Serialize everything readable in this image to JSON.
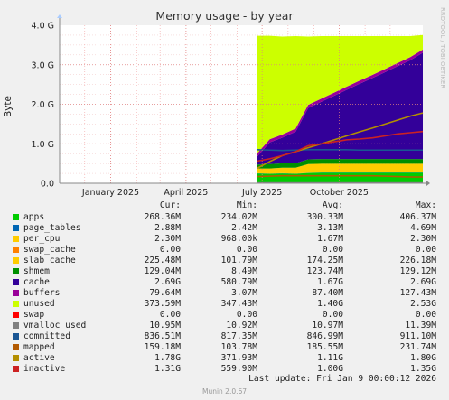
{
  "chart_data": {
    "type": "area",
    "title": "Memory usage - by year",
    "ylabel": "Bytes",
    "side_label": "RRDTOOL / TOBI OETIKER",
    "y_ticks": [
      "0.0",
      "1.0 G",
      "2.0 G",
      "3.0 G",
      "4.0 G"
    ],
    "y_tick_values": [
      0,
      1,
      2,
      3,
      4
    ],
    "ylim": [
      0,
      4
    ],
    "x_ticks": [
      "January 2025",
      "April 2025",
      "July 2025",
      "October 2025"
    ],
    "x_tick_values": [
      "2025-01-01",
      "2025-04-01",
      "2025-07-01",
      "2025-10-01"
    ],
    "xlim": [
      "2024-11-01",
      "2026-01-09"
    ],
    "data_start": "2025-06-25",
    "unit": "GB",
    "x": [
      "2025-06-25",
      "2025-07-10",
      "2025-07-25",
      "2025-08-10",
      "2025-08-25",
      "2025-09-10",
      "2025-09-25",
      "2025-10-10",
      "2025-10-25",
      "2025-11-10",
      "2025-11-25",
      "2025-12-10",
      "2025-12-25",
      "2026-01-09"
    ],
    "stack": [
      {
        "name": "apps",
        "color": "#00cc00",
        "values": [
          0.25,
          0.24,
          0.25,
          0.24,
          0.26,
          0.27,
          0.27,
          0.27,
          0.27,
          0.27,
          0.27,
          0.27,
          0.27,
          0.27
        ]
      },
      {
        "name": "page_tables",
        "color": "#0066b3",
        "values": [
          0.003,
          0.003,
          0.003,
          0.003,
          0.003,
          0.003,
          0.003,
          0.003,
          0.003,
          0.003,
          0.003,
          0.003,
          0.003,
          0.003
        ]
      },
      {
        "name": "per_cpu",
        "color": "#ff8000",
        "values": [
          0.002,
          0.002,
          0.002,
          0.002,
          0.002,
          0.002,
          0.002,
          0.002,
          0.002,
          0.002,
          0.002,
          0.002,
          0.002,
          0.002
        ]
      },
      {
        "name": "swap_cache",
        "color": "#ffcc00",
        "values": [
          0,
          0,
          0,
          0,
          0,
          0,
          0,
          0,
          0,
          0,
          0,
          0,
          0,
          0
        ]
      },
      {
        "name": "slab_cache",
        "color": "#ffcc00",
        "values": [
          0.12,
          0.13,
          0.14,
          0.15,
          0.22,
          0.22,
          0.22,
          0.22,
          0.22,
          0.22,
          0.22,
          0.22,
          0.22,
          0.22
        ]
      },
      {
        "name": "shmem",
        "color": "#008f00",
        "values": [
          0.1,
          0.11,
          0.11,
          0.11,
          0.12,
          0.12,
          0.12,
          0.12,
          0.12,
          0.12,
          0.12,
          0.12,
          0.12,
          0.12
        ]
      },
      {
        "name": "cache",
        "color": "#330099",
        "values": [
          0.2,
          0.55,
          0.65,
          0.8,
          1.3,
          1.45,
          1.6,
          1.75,
          1.9,
          2.05,
          2.2,
          2.35,
          2.5,
          2.69
        ]
      },
      {
        "name": "buffers",
        "color": "#990099",
        "values": [
          0.08,
          0.08,
          0.08,
          0.08,
          0.08,
          0.08,
          0.08,
          0.08,
          0.08,
          0.08,
          0.08,
          0.08,
          0.08,
          0.08
        ]
      },
      {
        "name": "unused",
        "color": "#ccff00",
        "values": [
          2.98,
          2.62,
          2.48,
          2.34,
          1.73,
          1.58,
          1.43,
          1.28,
          1.13,
          0.98,
          0.83,
          0.68,
          0.53,
          0.37
        ]
      },
      {
        "name": "swap",
        "color": "#ff0000",
        "values": [
          0,
          0,
          0,
          0,
          0,
          0,
          0,
          0,
          0,
          0,
          0,
          0,
          0,
          0
        ]
      }
    ],
    "lines": [
      {
        "name": "vmalloc_used",
        "color": "#808080",
        "values": [
          0.011,
          0.011,
          0.011,
          0.011,
          0.011,
          0.011,
          0.011,
          0.011,
          0.011,
          0.011,
          0.011,
          0.011,
          0.011,
          0.011
        ]
      },
      {
        "name": "committed",
        "color": "#1a5694",
        "values": [
          0.85,
          0.84,
          0.83,
          0.84,
          0.85,
          0.85,
          0.85,
          0.85,
          0.84,
          0.84,
          0.84,
          0.84,
          0.84,
          0.84
        ]
      },
      {
        "name": "mapped",
        "color": "#b35a00",
        "values": [
          0.17,
          0.18,
          0.19,
          0.19,
          0.19,
          0.19,
          0.19,
          0.19,
          0.19,
          0.19,
          0.18,
          0.17,
          0.16,
          0.16
        ]
      },
      {
        "name": "active",
        "color": "#b38f00",
        "values": [
          0.38,
          0.55,
          0.7,
          0.8,
          0.9,
          1.0,
          1.1,
          1.2,
          1.3,
          1.4,
          1.5,
          1.6,
          1.7,
          1.78
        ]
      },
      {
        "name": "inactive",
        "color": "#cc2222",
        "values": [
          0.56,
          0.62,
          0.7,
          0.8,
          0.95,
          1.0,
          1.05,
          1.1,
          1.12,
          1.15,
          1.2,
          1.25,
          1.28,
          1.31
        ]
      }
    ]
  },
  "legend": {
    "headers": [
      "Cur:",
      "Min:",
      "Avg:",
      "Max:"
    ],
    "rows": [
      {
        "name": "apps",
        "color": "#00cc00",
        "cur": "268.36M",
        "min": "234.02M",
        "avg": "300.33M",
        "max": "406.37M"
      },
      {
        "name": "page_tables",
        "color": "#0066b3",
        "cur": "2.88M",
        "min": "2.42M",
        "avg": "3.13M",
        "max": "4.69M"
      },
      {
        "name": "per_cpu",
        "color": "#ffcc00",
        "cur": "2.30M",
        "min": "968.00k",
        "avg": "1.67M",
        "max": "2.30M"
      },
      {
        "name": "swap_cache",
        "color": "#ff8000",
        "cur": "0.00",
        "min": "0.00",
        "avg": "0.00",
        "max": "0.00"
      },
      {
        "name": "slab_cache",
        "color": "#ffcc00",
        "cur": "225.48M",
        "min": "101.79M",
        "avg": "174.25M",
        "max": "226.18M"
      },
      {
        "name": "shmem",
        "color": "#008f00",
        "cur": "129.04M",
        "min": "8.49M",
        "avg": "123.74M",
        "max": "129.12M"
      },
      {
        "name": "cache",
        "color": "#330099",
        "cur": "2.69G",
        "min": "580.79M",
        "avg": "1.67G",
        "max": "2.69G"
      },
      {
        "name": "buffers",
        "color": "#990099",
        "cur": "79.64M",
        "min": "3.07M",
        "avg": "87.40M",
        "max": "127.43M"
      },
      {
        "name": "unused",
        "color": "#ccff00",
        "cur": "373.59M",
        "min": "347.43M",
        "avg": "1.40G",
        "max": "2.53G"
      },
      {
        "name": "swap",
        "color": "#ff0000",
        "cur": "0.00",
        "min": "0.00",
        "avg": "0.00",
        "max": "0.00"
      },
      {
        "name": "vmalloc_used",
        "color": "#808080",
        "cur": "10.95M",
        "min": "10.92M",
        "avg": "10.97M",
        "max": "11.39M"
      },
      {
        "name": "committed",
        "color": "#1a5694",
        "cur": "836.51M",
        "min": "817.35M",
        "avg": "846.99M",
        "max": "911.10M"
      },
      {
        "name": "mapped",
        "color": "#b35a00",
        "cur": "159.18M",
        "min": "103.78M",
        "avg": "185.55M",
        "max": "231.74M"
      },
      {
        "name": "active",
        "color": "#b38f00",
        "cur": "1.78G",
        "min": "371.93M",
        "avg": "1.11G",
        "max": "1.80G"
      },
      {
        "name": "inactive",
        "color": "#cc2222",
        "cur": "1.31G",
        "min": "559.90M",
        "avg": "1.00G",
        "max": "1.35G"
      }
    ]
  },
  "footer": {
    "last_update": "Last update: Fri Jan  9 00:00:12 2026",
    "version": "Munin 2.0.67"
  }
}
